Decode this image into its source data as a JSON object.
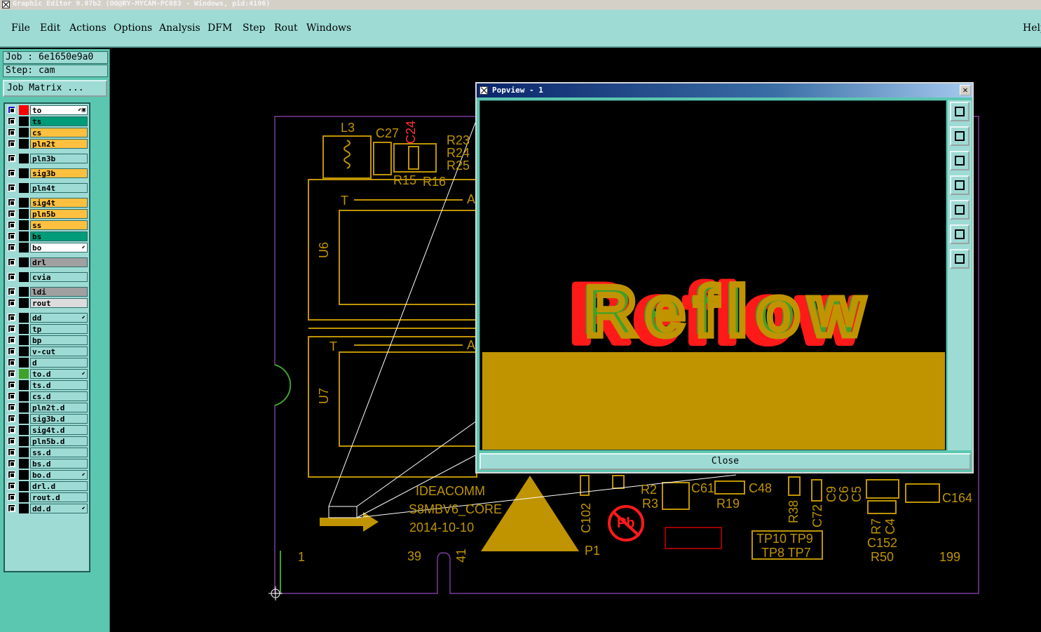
{
  "window": {
    "title": "Graphic Editor 9.07b2  (OO@RY-MYCAM-PC083 - Windows, pid:4196)"
  },
  "menu": {
    "items": [
      "File",
      "Edit",
      "Actions",
      "Options",
      "Analysis",
      "DFM",
      "Step",
      "Rout",
      "Windows"
    ],
    "help": "Help"
  },
  "job": {
    "label": "Job : 6e1650e9a0",
    "step": "Step: cam",
    "matrix_button": "Job Matrix ..."
  },
  "layers": [
    {
      "name": "to",
      "color": "#ffffff",
      "flag": "⬋▣",
      "selected": true,
      "marker": "#ff0000"
    },
    {
      "name": "ts",
      "color": "#009b78",
      "flag": ""
    },
    {
      "name": "cs",
      "color": "#ffc040",
      "flag": ""
    },
    {
      "name": "pln2t",
      "color": "#ffc040",
      "flag": ""
    },
    {
      "name": "pln3b",
      "color": "#9edbd5",
      "flag": ""
    },
    {
      "name": "sig3b",
      "color": "#ffc040",
      "flag": ""
    },
    {
      "name": "pln4t",
      "color": "#9edbd5",
      "flag": ""
    },
    {
      "name": "sig4t",
      "color": "#ffc040",
      "flag": ""
    },
    {
      "name": "pln5b",
      "color": "#ffc040",
      "flag": ""
    },
    {
      "name": "ss",
      "color": "#ffc040",
      "flag": ""
    },
    {
      "name": "bs",
      "color": "#009b78",
      "flag": ""
    },
    {
      "name": "bo",
      "color": "#ffffff",
      "flag": "⬋"
    },
    {
      "name": "drl",
      "color": "#a0a0a0",
      "flag": ""
    },
    {
      "name": "cvia",
      "color": "#9edbd5",
      "flag": ""
    },
    {
      "name": "ldi",
      "color": "#a0a0a0",
      "flag": ""
    },
    {
      "name": "rout",
      "color": "#dcdcdc",
      "flag": ""
    },
    {
      "name": "dd",
      "color": "#9edbd5",
      "flag": "⬋"
    },
    {
      "name": "tp",
      "color": "#9edbd5",
      "flag": ""
    },
    {
      "name": "bp",
      "color": "#9edbd5",
      "flag": ""
    },
    {
      "name": "v-cut",
      "color": "#9edbd5",
      "flag": ""
    },
    {
      "name": "d",
      "color": "#9edbd5",
      "flag": ""
    },
    {
      "name": "to.d",
      "color": "#9edbd5",
      "flag": "⬋",
      "marker": "#3fa12b"
    },
    {
      "name": "ts.d",
      "color": "#9edbd5",
      "flag": ""
    },
    {
      "name": "cs.d",
      "color": "#9edbd5",
      "flag": ""
    },
    {
      "name": "pln2t.d",
      "color": "#9edbd5",
      "flag": ""
    },
    {
      "name": "sig3b.d",
      "color": "#9edbd5",
      "flag": ""
    },
    {
      "name": "sig4t.d",
      "color": "#9edbd5",
      "flag": ""
    },
    {
      "name": "pln5b.d",
      "color": "#9edbd5",
      "flag": ""
    },
    {
      "name": "ss.d",
      "color": "#9edbd5",
      "flag": ""
    },
    {
      "name": "bs.d",
      "color": "#9edbd5",
      "flag": ""
    },
    {
      "name": "bo.d",
      "color": "#9edbd5",
      "flag": "⬋"
    },
    {
      "name": "drl.d",
      "color": "#9edbd5",
      "flag": ""
    },
    {
      "name": "rout.d",
      "color": "#9edbd5",
      "flag": ""
    },
    {
      "name": "dd.d",
      "color": "#9edbd5",
      "flag": "⬋"
    }
  ],
  "pcb": {
    "labels": [
      "L3",
      "C27",
      "C24",
      "R23",
      "R24",
      "R25",
      "R15",
      "R16",
      "T",
      "A",
      "U6",
      "T",
      "A",
      "U7",
      "IDEACOMM",
      "S8MBV6_CORE",
      "2014-10-10",
      "1",
      "39",
      "41",
      "P1",
      "C102",
      "R2",
      "R3",
      "C61",
      "R19",
      "C48",
      "R38",
      "C72",
      "C9",
      "C6",
      "C5",
      "C164",
      "R7",
      "C4",
      "C152",
      "R50",
      "199",
      "TP10 TP9",
      "TP8  TP7",
      "Pb"
    ],
    "silk_color": "#bf9400",
    "outline_color": "#7a3b9a"
  },
  "popview": {
    "title": "Popview - 1",
    "text": "Reflow",
    "close_label": "Close",
    "close_x": "✕",
    "tools": [
      "zoom-fit-icon",
      "pan-up-icon",
      "pan-down-icon",
      "pan-left-icon",
      "pan-right-icon",
      "zoom-home-icon",
      "zoom-center-icon"
    ]
  },
  "colors": {
    "panel": "#5cc7b0",
    "panel_light": "#9edbd5",
    "red": "#ff1a1a",
    "green": "#3fa12b"
  }
}
